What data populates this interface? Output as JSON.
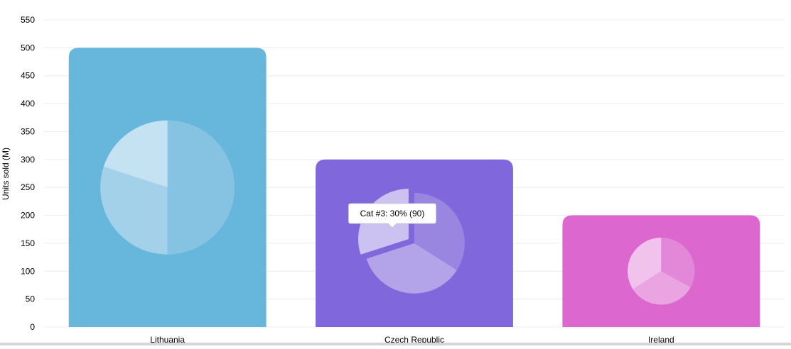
{
  "chart_data": {
    "type": "bar",
    "ylabel": "Units sold (M)",
    "ylim": [
      0,
      550
    ],
    "yticks": [
      0,
      50,
      100,
      150,
      200,
      250,
      300,
      350,
      400,
      450,
      500,
      550
    ],
    "grid": true,
    "categories": [
      "Lithuania",
      "Czech Republic",
      "Ireland"
    ],
    "values": [
      500,
      300,
      200
    ],
    "bar_colors": [
      "#67b7dc",
      "#8067dc",
      "#dc67ce"
    ],
    "pies": [
      {
        "category": "Lithuania",
        "slices": [
          50,
          30,
          20
        ],
        "colors": [
          "#86c2e1",
          "#a3d1e9",
          "#c4e2f2"
        ]
      },
      {
        "category": "Czech Republic",
        "slices": [
          34,
          36,
          30
        ],
        "colors": [
          "#9886e1",
          "#b3a4e9",
          "#ccc2f1"
        ],
        "exploded_index": 2
      },
      {
        "category": "Ireland",
        "slices": [
          33,
          33,
          34
        ],
        "colors": [
          "#e387d8",
          "#eaa4e2",
          "#f1c2ec"
        ]
      }
    ],
    "tooltip": {
      "text": "Cat #3: 30% (90)"
    }
  }
}
